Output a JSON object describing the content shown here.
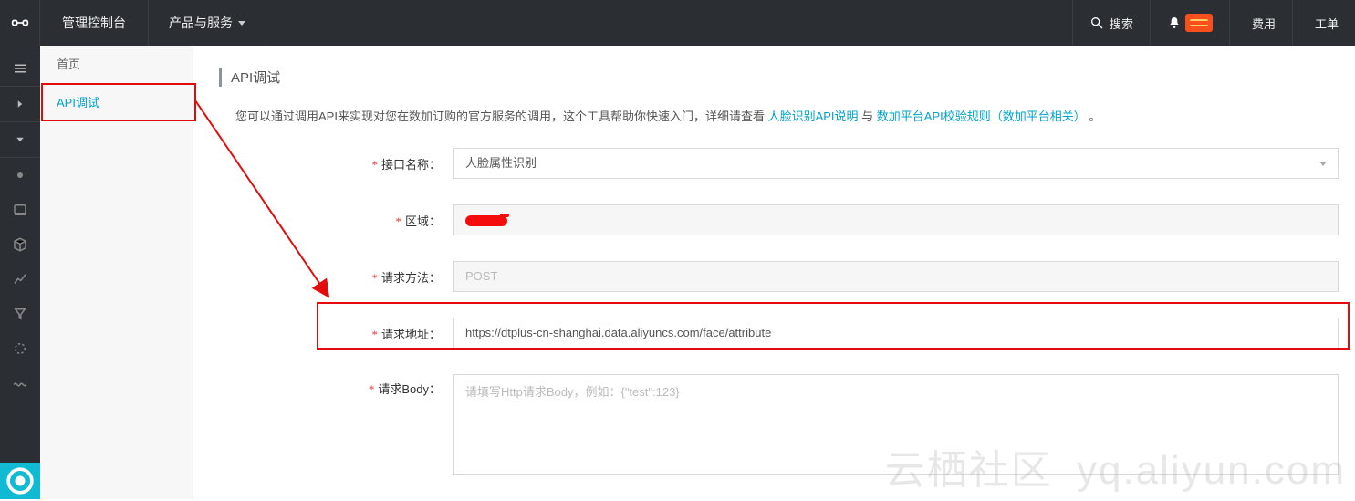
{
  "topbar": {
    "console_title": "管理控制台",
    "products_label": "产品与服务",
    "search_label": "搜索",
    "fee_label": "费用",
    "ticket_label": "工单"
  },
  "icon_rail": {
    "items": [
      {
        "name": "menu-icon"
      },
      {
        "name": "caret-right"
      },
      {
        "name": "caret-down"
      },
      {
        "name": "dot"
      },
      {
        "name": "console"
      },
      {
        "name": "cube"
      },
      {
        "name": "graph"
      },
      {
        "name": "filter"
      },
      {
        "name": "ring"
      },
      {
        "name": "wave"
      }
    ]
  },
  "left_menu": {
    "items": [
      {
        "label": "首页",
        "active": false
      },
      {
        "label": "API调试",
        "active": true
      }
    ]
  },
  "page": {
    "title": "API调试",
    "desc_prefix": "您可以通过调用API来实现对您在数加订购的官方服务的调用，这个工具帮助你快速入门，详细请查看 ",
    "desc_link1": "人脸识别API说明",
    "desc_mid": " 与 ",
    "desc_link2": "数加平台API校验规则（数加平台相关）",
    "desc_suffix": "。"
  },
  "form": {
    "interface_label": "接口名称：",
    "interface_value": "人脸属性识别",
    "region_label": "区域：",
    "region_value": "█████",
    "method_label": "请求方法：",
    "method_value": "POST",
    "url_label": "请求地址：",
    "url_value": "https://dtplus-cn-shanghai.data.aliyuncs.com/face/attribute",
    "body_label": "请求Body：",
    "body_placeholder": "请填写Http请求Body，例如：{\"test\":123}"
  },
  "watermark": {
    "text_cn": "云栖社区",
    "text_en": "yq.aliyun.com"
  }
}
